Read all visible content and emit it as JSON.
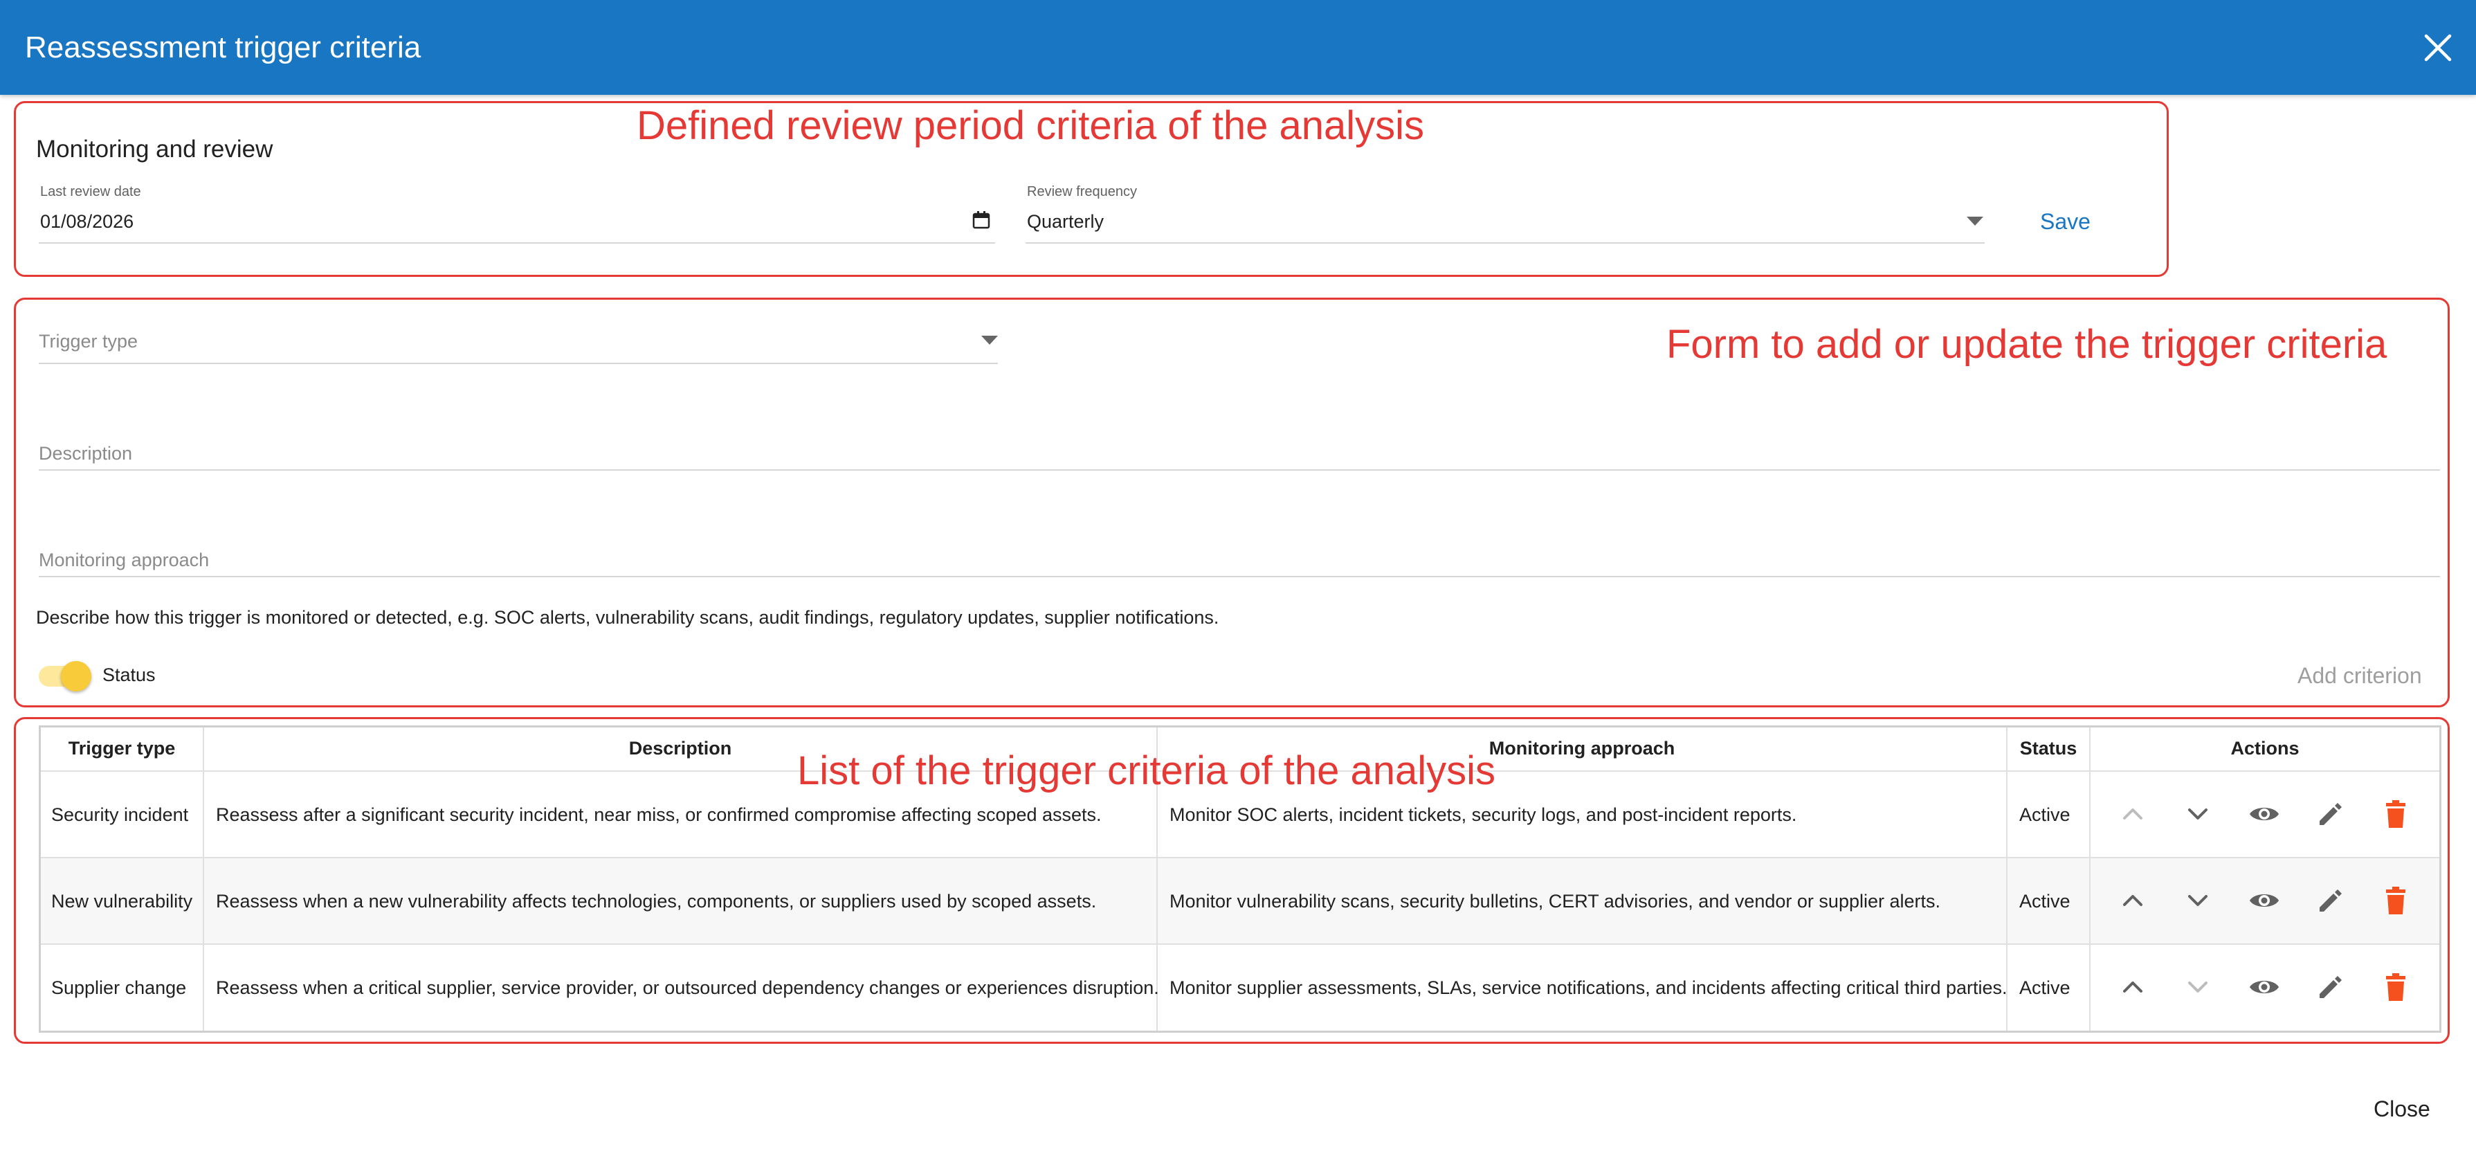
{
  "dialog": {
    "title": "Reassessment trigger criteria",
    "close_label": "Close"
  },
  "annotations": {
    "review_period": "Defined review period criteria of the analysis",
    "form": "Form to add or update the trigger criteria",
    "list": "List of the trigger criteria of the analysis"
  },
  "monitoring": {
    "title": "Monitoring and review",
    "last_review_label": "Last review date",
    "last_review_value": "01/08/2026",
    "frequency_label": "Review frequency",
    "frequency_value": "Quarterly",
    "save_label": "Save"
  },
  "form": {
    "trigger_type_placeholder": "Trigger type",
    "description_placeholder": "Description",
    "monitoring_placeholder": "Monitoring approach",
    "hint": "Describe how this trigger is monitored or detected, e.g. SOC alerts, vulnerability scans, audit findings, regulatory updates, supplier notifications.",
    "status_label": "Status",
    "status_on": true,
    "add_label": "Add criterion"
  },
  "table": {
    "headers": [
      "Trigger type",
      "Description",
      "Monitoring approach",
      "Status",
      "Actions"
    ],
    "rows": [
      {
        "trigger_type": "Security incident",
        "description": "Reassess after a significant security incident, near miss, or confirmed compromise affecting scoped assets.",
        "monitoring": "Monitor SOC alerts, incident tickets, security logs, and post-incident reports.",
        "status": "Active"
      },
      {
        "trigger_type": "New vulnerability",
        "description": "Reassess when a new vulnerability affects technologies, components, or suppliers used by scoped assets.",
        "monitoring": "Monitor vulnerability scans, security bulletins, CERT advisories, and vendor or supplier alerts.",
        "status": "Active"
      },
      {
        "trigger_type": "Supplier change",
        "description": "Reassess when a critical supplier, service provider, or outsourced dependency changes or experiences disruption.",
        "monitoring": "Monitor supplier assessments, SLAs, service notifications, and incidents affecting critical third parties.",
        "status": "Active"
      }
    ]
  },
  "colors": {
    "header_bg": "#1976c2",
    "accent_blue": "#1976c2",
    "annotation_red": "#e53935",
    "delete_orange": "#f4511e",
    "toggle_yellow": "#f7cb3a"
  },
  "icons": {
    "close": "close-icon",
    "calendar": "calendar-icon",
    "dropdown": "caret-down-icon",
    "move_up": "chevron-up-icon",
    "move_down": "chevron-down-icon",
    "view": "eye-icon",
    "edit": "pencil-icon",
    "delete": "trash-icon"
  }
}
